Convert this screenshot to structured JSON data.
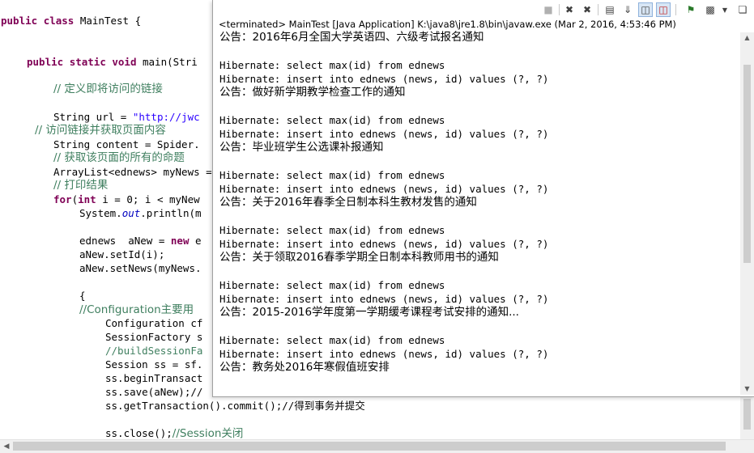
{
  "editor": {
    "lines": [
      {
        "segments": [
          {
            "t": "public",
            "c": "kw"
          },
          {
            "t": " ",
            "c": "plain"
          },
          {
            "t": "class",
            "c": "kw"
          },
          {
            "t": " MainTest {",
            "c": "plain"
          }
        ]
      },
      {
        "segments": [
          {
            "t": "public",
            "c": "kw"
          },
          {
            "t": " ",
            "c": "plain"
          },
          {
            "t": "static",
            "c": "kw"
          },
          {
            "t": " ",
            "c": "plain"
          },
          {
            "t": "void",
            "c": "kw"
          },
          {
            "t": " main(Stri",
            "c": "plain"
          }
        ]
      },
      {
        "segments": [
          {
            "t": "// 定义即将访问的链接",
            "c": "cm"
          }
        ]
      },
      {
        "segments": [
          {
            "t": "String url = ",
            "c": "plain"
          },
          {
            "t": "\"http://jwc",
            "c": "str"
          }
        ]
      },
      {
        "segments": [
          {
            "t": "// 访问链接并获取页面内容",
            "c": "cm"
          }
        ]
      },
      {
        "segments": [
          {
            "t": "String content = Spider.",
            "c": "plain"
          }
        ]
      },
      {
        "segments": [
          {
            "t": "// 获取该页面的所有的命题",
            "c": "cm"
          }
        ]
      },
      {
        "segments": [
          {
            "t": "ArrayList<ednews> myNews =",
            "c": "plain"
          }
        ]
      },
      {
        "segments": [
          {
            "t": "// 打印结果",
            "c": "cm"
          }
        ]
      },
      {
        "segments": [
          {
            "t": "for",
            "c": "kw"
          },
          {
            "t": "(",
            "c": "plain"
          },
          {
            "t": "int",
            "c": "kw"
          },
          {
            "t": " i = 0; i < myNew",
            "c": "plain"
          }
        ]
      },
      {
        "segments": [
          {
            "t": "System.",
            "c": "plain"
          },
          {
            "t": "out",
            "c": "fld"
          },
          {
            "t": ".println(m",
            "c": "plain"
          }
        ]
      },
      {
        "segments": [
          {
            "t": "ednews  aNew = ",
            "c": "plain"
          },
          {
            "t": "new",
            "c": "kw"
          },
          {
            "t": " e",
            "c": "plain"
          }
        ]
      },
      {
        "segments": [
          {
            "t": "aNew.setId(i);",
            "c": "plain"
          }
        ]
      },
      {
        "segments": [
          {
            "t": "aNew.setNews(myNews.",
            "c": "plain"
          }
        ]
      },
      {
        "segments": [
          {
            "t": "{",
            "c": "plain"
          }
        ]
      },
      {
        "segments": [
          {
            "t": "//Configuration主要用",
            "c": "cm"
          }
        ]
      },
      {
        "segments": [
          {
            "t": "Configuration cf",
            "c": "plain"
          }
        ]
      },
      {
        "segments": [
          {
            "t": "SessionFactory s",
            "c": "plain"
          }
        ]
      },
      {
        "segments": [
          {
            "t": "//buildSessionFa",
            "c": "cm"
          }
        ]
      },
      {
        "segments": [
          {
            "t": "Session ss = sf.",
            "c": "plain"
          }
        ]
      },
      {
        "segments": [
          {
            "t": "ss.beginTransact",
            "c": "plain"
          }
        ]
      },
      {
        "segments": [
          {
            "t": "ss.save(aNew);//",
            "c": "plain"
          }
        ]
      },
      {
        "segments": [
          {
            "t": "ss.getTransaction().commit();//得到事务并提交",
            "c": "plain"
          }
        ]
      },
      {
        "segments": [
          {
            "t": "ss.close();",
            "c": "plain"
          },
          {
            "t": "//Session关闭",
            "c": "cm"
          }
        ]
      }
    ]
  },
  "console": {
    "status": "<terminated> MainTest [Java Application] K:\\java8\\jre1.8\\bin\\javaw.exe (Mar 2, 2016, 4:53:46 PM)",
    "toolbar": {
      "terminate_icon": "terminate-icon",
      "remove_launch_icon": "remove-launch-icon",
      "remove_all_icon": "remove-all-terminated-icon",
      "clear_icon": "clear-console-icon",
      "scroll_lock_icon": "scroll-lock-icon",
      "show_stdout_icon": "show-console-on-stdout-icon",
      "show_stderr_icon": "show-console-on-stderr-icon",
      "pin_icon": "pin-console-icon",
      "display_console_icon": "display-console-icon",
      "new_console_icon": "open-console-icon"
    },
    "lines": [
      "公告：2016年6月全国大学英语四、六级考试报名通知",
      "",
      "Hibernate: select max(id) from ednews",
      "Hibernate: insert into ednews (news, id) values (?, ?)",
      "公告：做好新学期教学检查工作的通知",
      "",
      "Hibernate: select max(id) from ednews",
      "Hibernate: insert into ednews (news, id) values (?, ?)",
      "公告：毕业班学生公选课补报通知",
      "",
      "Hibernate: select max(id) from ednews",
      "Hibernate: insert into ednews (news, id) values (?, ?)",
      "公告：关于2016年春季全日制本科生教材发售的通知",
      "",
      "Hibernate: select max(id) from ednews",
      "Hibernate: insert into ednews (news, id) values (?, ?)",
      "公告：关于领取2016春季学期全日制本科教师用书的通知",
      "",
      "Hibernate: select max(id) from ednews",
      "Hibernate: insert into ednews (news, id) values (?, ?)",
      "公告：2015-2016学年度第一学期缓考课程考试安排的通知...",
      "",
      "Hibernate: select max(id) from ednews",
      "Hibernate: insert into ednews (news, id) values (?, ?)",
      "公告：教务处2016年寒假值班安排"
    ]
  },
  "colors": {
    "keyword": "#7f0055",
    "string": "#2a00ff",
    "comment": "#3f7f5f",
    "field": "#0000c0"
  }
}
